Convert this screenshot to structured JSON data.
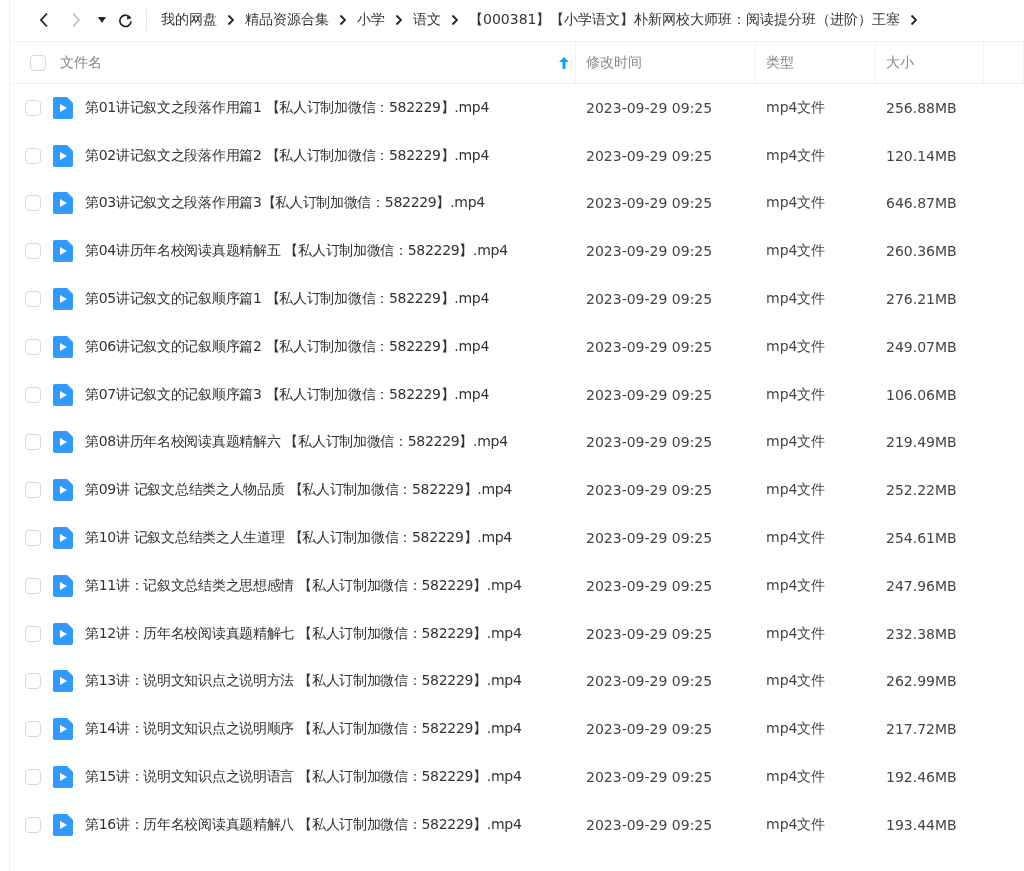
{
  "select_all_checked": false,
  "breadcrumb": [
    "我的网盘",
    "精品资源合集",
    "小学",
    "语文",
    "【000381】【小学语文】朴新网校大师班：阅读提分班（进阶）王塞"
  ],
  "columns": [
    {
      "label": "文件名",
      "sorted": true
    },
    {
      "label": "修改时间",
      "sorted": false
    },
    {
      "label": "类型",
      "sorted": false
    },
    {
      "label": "大小",
      "sorted": false
    }
  ],
  "rows": [
    {
      "name": "第01讲记叙文之段落作用篇1 【私人订制加微信：582229】.mp4",
      "modified": "2023-09-29 09:25",
      "type": "mp4文件",
      "size": "256.88MB",
      "checked": false
    },
    {
      "name": "第02讲记叙文之段落作用篇2 【私人订制加微信：582229】.mp4",
      "modified": "2023-09-29 09:25",
      "type": "mp4文件",
      "size": "120.14MB",
      "checked": false
    },
    {
      "name": "第03讲记叙文之段落作用篇3【私人订制加微信：582229】.mp4",
      "modified": "2023-09-29 09:25",
      "type": "mp4文件",
      "size": "646.87MB",
      "checked": false
    },
    {
      "name": "第04讲历年名校阅读真题精解五 【私人订制加微信：582229】.mp4",
      "modified": "2023-09-29 09:25",
      "type": "mp4文件",
      "size": "260.36MB",
      "checked": false
    },
    {
      "name": "第05讲记叙文的记叙顺序篇1 【私人订制加微信：582229】.mp4",
      "modified": "2023-09-29 09:25",
      "type": "mp4文件",
      "size": "276.21MB",
      "checked": false
    },
    {
      "name": "第06讲记叙文的记叙顺序篇2 【私人订制加微信：582229】.mp4",
      "modified": "2023-09-29 09:25",
      "type": "mp4文件",
      "size": "249.07MB",
      "checked": false
    },
    {
      "name": "第07讲记叙文的记叙顺序篇3 【私人订制加微信：582229】.mp4",
      "modified": "2023-09-29 09:25",
      "type": "mp4文件",
      "size": "106.06MB",
      "checked": false
    },
    {
      "name": "第08讲历年名校阅读真题精解六 【私人订制加微信：582229】.mp4",
      "modified": "2023-09-29 09:25",
      "type": "mp4文件",
      "size": "219.49MB",
      "checked": false
    },
    {
      "name": "第09讲 记叙文总结类之人物品质 【私人订制加微信：582229】.mp4",
      "modified": "2023-09-29 09:25",
      "type": "mp4文件",
      "size": "252.22MB",
      "checked": false
    },
    {
      "name": "第10讲 记叙文总结类之人生道理 【私人订制加微信：582229】.mp4",
      "modified": "2023-09-29 09:25",
      "type": "mp4文件",
      "size": "254.61MB",
      "checked": false
    },
    {
      "name": "第11讲：记叙文总结类之思想感情 【私人订制加微信：582229】.mp4",
      "modified": "2023-09-29 09:25",
      "type": "mp4文件",
      "size": "247.96MB",
      "checked": false
    },
    {
      "name": "第12讲：历年名校阅读真题精解七 【私人订制加微信：582229】.mp4",
      "modified": "2023-09-29 09:25",
      "type": "mp4文件",
      "size": "232.38MB",
      "checked": false
    },
    {
      "name": "第13讲：说明文知识点之说明方法 【私人订制加微信：582229】.mp4",
      "modified": "2023-09-29 09:25",
      "type": "mp4文件",
      "size": "262.99MB",
      "checked": false
    },
    {
      "name": "第14讲：说明文知识点之说明顺序 【私人订制加微信：582229】.mp4",
      "modified": "2023-09-29 09:25",
      "type": "mp4文件",
      "size": "217.72MB",
      "checked": false
    },
    {
      "name": "第15讲：说明文知识点之说明语言 【私人订制加微信：582229】.mp4",
      "modified": "2023-09-29 09:25",
      "type": "mp4文件",
      "size": "192.46MB",
      "checked": false
    },
    {
      "name": "第16讲：历年名校阅读真题精解八 【私人订制加微信：582229】.mp4",
      "modified": "2023-09-29 09:25",
      "type": "mp4文件",
      "size": "193.44MB",
      "checked": false
    }
  ]
}
